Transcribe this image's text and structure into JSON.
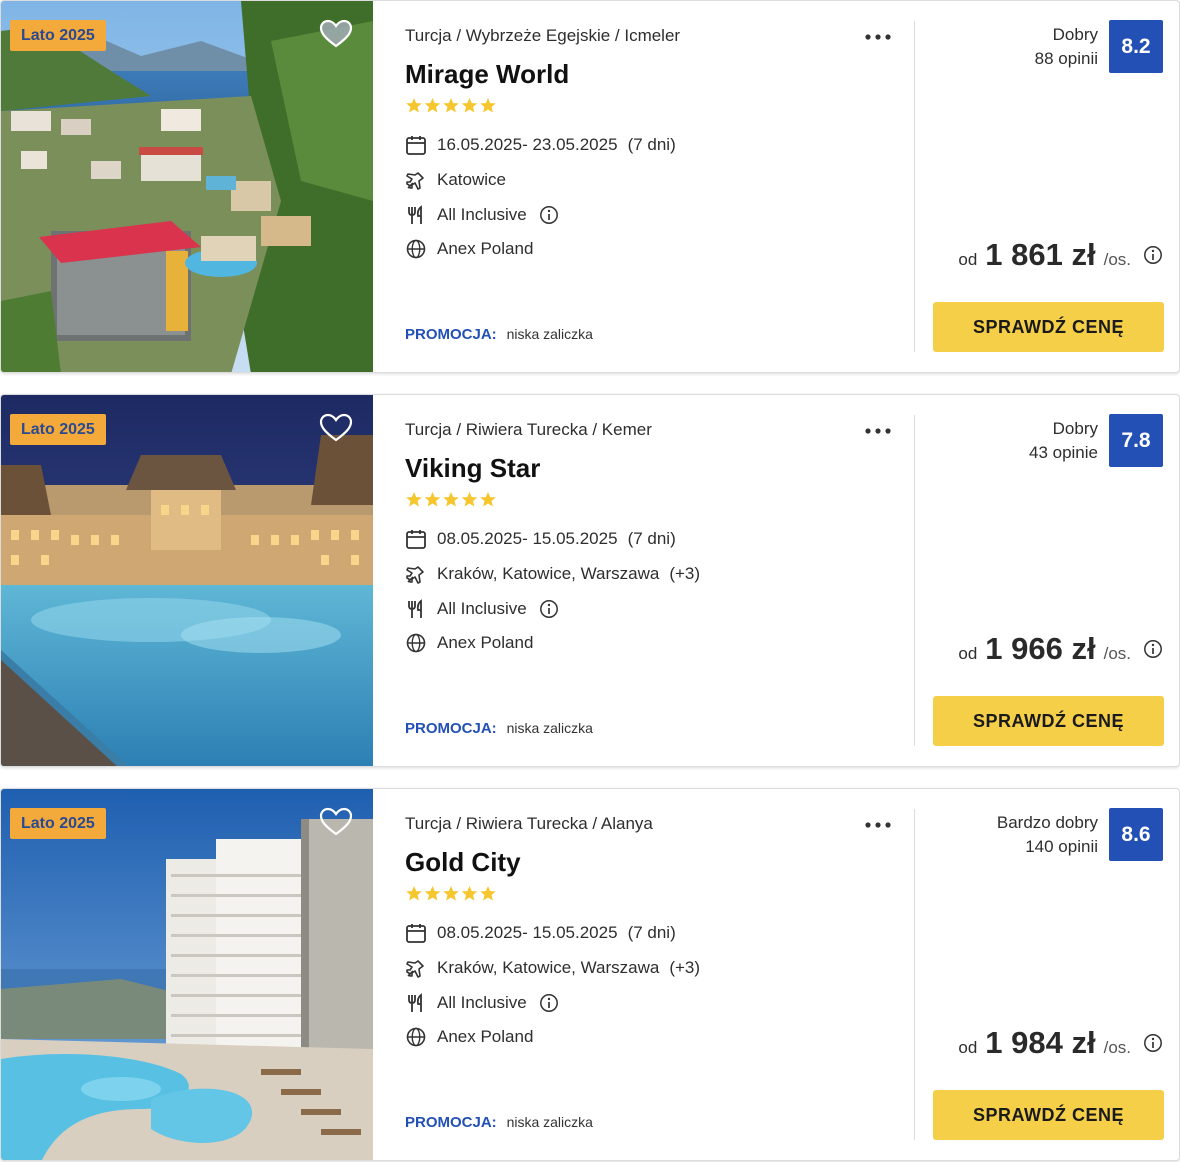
{
  "offers": [
    {
      "season_badge": "Lato 2025",
      "location": "Turcja / Wybrzeże Egejskie / Icmeler",
      "name": "Mirage World",
      "stars": 5,
      "dates": "16.05.2025- 23.05.2025",
      "duration": "(7 dni)",
      "departure": "Katowice",
      "departure_extra": "",
      "board": "All Inclusive",
      "operator": "Anex Poland",
      "promo_label": "PROMOCJA:",
      "promo_text": "niska zaliczka",
      "rating_label": "Dobry",
      "reviews": "88 opinii",
      "score": "8.2",
      "price_prefix": "od",
      "price": "1 861 zł",
      "price_unit": "/os.",
      "cta": "SPRAWDŹ CENĘ",
      "favorite_filled": true,
      "image": "coastal-resort-hillside-photo"
    },
    {
      "season_badge": "Lato 2025",
      "location": "Turcja / Riwiera Turecka / Kemer",
      "name": "Viking Star",
      "stars": 5,
      "dates": "08.05.2025- 15.05.2025",
      "duration": "(7 dni)",
      "departure": "Kraków, Katowice, Warszawa",
      "departure_extra": "(+3)",
      "board": "All Inclusive",
      "operator": "Anex Poland",
      "promo_label": "PROMOCJA:",
      "promo_text": "niska zaliczka",
      "rating_label": "Dobry",
      "reviews": "43 opinie",
      "score": "7.8",
      "price_prefix": "od",
      "price": "1 966 zł",
      "price_unit": "/os.",
      "cta": "SPRAWDŹ CENĘ",
      "favorite_filled": false,
      "image": "night-pool-hotel-photo"
    },
    {
      "season_badge": "Lato 2025",
      "location": "Turcja / Riwiera Turecka / Alanya",
      "name": "Gold City",
      "stars": 5,
      "dates": "08.05.2025- 15.05.2025",
      "duration": "(7 dni)",
      "departure": "Kraków, Katowice, Warszawa",
      "departure_extra": "(+3)",
      "board": "All Inclusive",
      "operator": "Anex Poland",
      "promo_label": "PROMOCJA:",
      "promo_text": "niska zaliczka",
      "rating_label": "Bardzo dobry",
      "reviews": "140 opinii",
      "score": "8.6",
      "price_prefix": "od",
      "price": "1 984 zł",
      "price_unit": "/os.",
      "cta": "SPRAWDŹ CENĘ",
      "favorite_filled": false,
      "image": "high-rise-hotel-pool-photo"
    }
  ],
  "colors": {
    "badge_bg": "#f4a93b",
    "badge_text": "#2b4a8f",
    "score_bg": "#2350b5",
    "promo_label": "#2350b5",
    "cta_bg": "#f5cf47",
    "star": "#f6c62f"
  },
  "icons": {
    "favorite": "heart-icon",
    "more": "more-dots-icon",
    "star": "star-icon",
    "dates": "calendar-icon",
    "departure": "plane-icon",
    "board": "fork-knife-icon",
    "operator": "globe-icon",
    "info": "info-icon"
  }
}
